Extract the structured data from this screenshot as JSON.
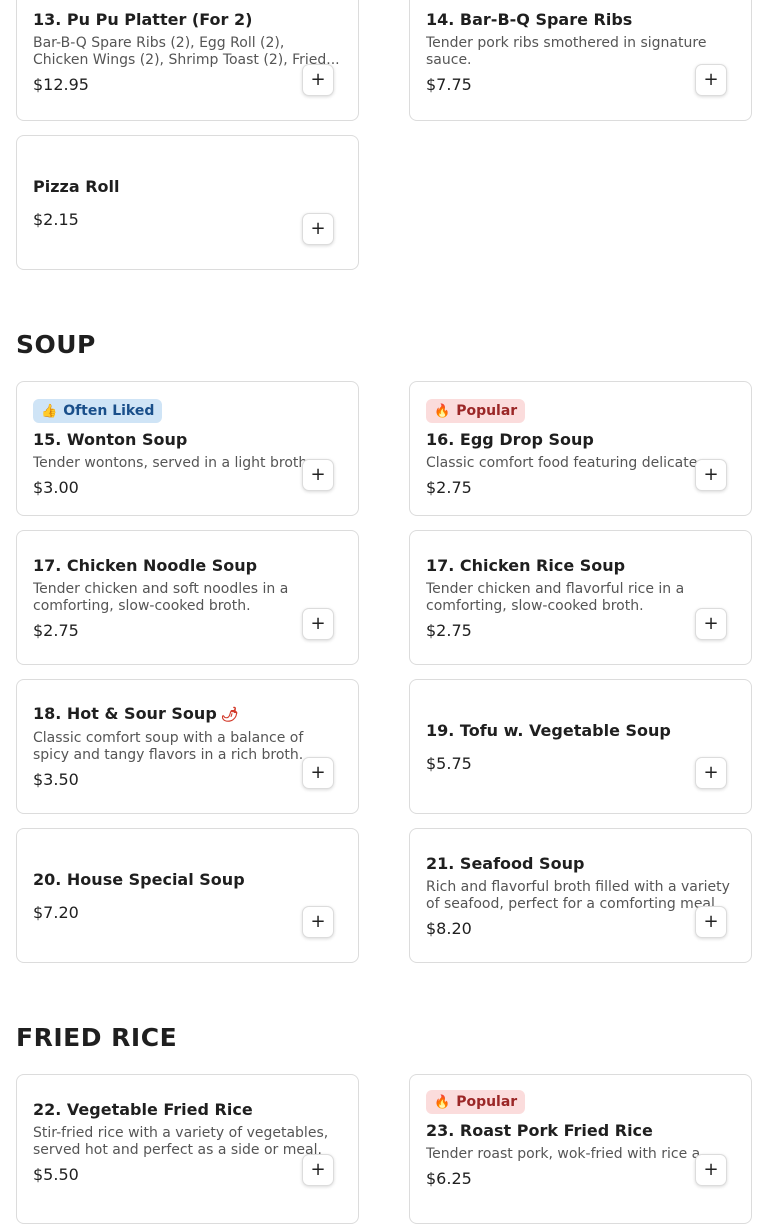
{
  "colors": {
    "often_liked_bg": "#cfe4f6",
    "popular_bg": "#fbdcdc",
    "spicy": "#d23a2a"
  },
  "add_label": "+",
  "sections": {
    "soup": {
      "title": "SOUP"
    },
    "fried_rice": {
      "title": "FRIED RICE"
    }
  },
  "items": {
    "i13": {
      "name": "13. Pu Pu Platter (For 2)",
      "desc": "Bar-B-Q Spare Ribs (2), Egg Roll (2), Chicken Wings (2), Shrimp Toast (2), Fried...",
      "price": "$12.95"
    },
    "i14": {
      "name": "14. Bar-B-Q Spare Ribs",
      "desc": "Tender pork ribs smothered in signature sauce.",
      "price": "$7.75"
    },
    "pizza": {
      "name": "Pizza Roll",
      "price": "$2.15"
    },
    "i15": {
      "badge": "Often Liked",
      "badge_icon": "thumbs-up-icon",
      "name": "15. Wonton Soup",
      "desc": "Tender wontons, served in a light broth...",
      "price": "$3.00"
    },
    "i16": {
      "badge": "Popular",
      "badge_icon": "fire-icon",
      "name": "16. Egg Drop Soup",
      "desc": "Classic comfort food featuring delicate e...",
      "price": "$2.75"
    },
    "i17a": {
      "name": "17. Chicken Noodle Soup",
      "desc": "Tender chicken and soft noodles in a comforting, slow-cooked broth.",
      "price": "$2.75"
    },
    "i17b": {
      "name": "17. Chicken Rice Soup",
      "desc": "Tender chicken and flavorful rice in a comforting, slow-cooked broth.",
      "price": "$2.75"
    },
    "i18": {
      "name": "18. Hot & Sour Soup",
      "spicy_icon": "chili-icon",
      "desc": "Classic comfort soup with a balance of spicy and tangy flavors in a rich broth.",
      "price": "$3.50"
    },
    "i19": {
      "name": "19. Tofu w. Vegetable Soup",
      "price": "$5.75"
    },
    "i20": {
      "name": "20. House Special Soup",
      "price": "$7.20"
    },
    "i21": {
      "name": "21. Seafood Soup",
      "desc": "Rich and flavorful broth filled with a variety of seafood, perfect for a comforting meal.",
      "price": "$8.20"
    },
    "i22": {
      "name": "22. Vegetable Fried Rice",
      "desc": "Stir-fried rice with a variety of vegetables, served hot and perfect as a side or meal.",
      "price": "$5.50"
    },
    "i23": {
      "badge": "Popular",
      "badge_icon": "fire-icon",
      "name": "23. Roast Pork Fried Rice",
      "desc": "Tender roast pork, wok-fried with rice a...",
      "price": "$6.25"
    }
  }
}
